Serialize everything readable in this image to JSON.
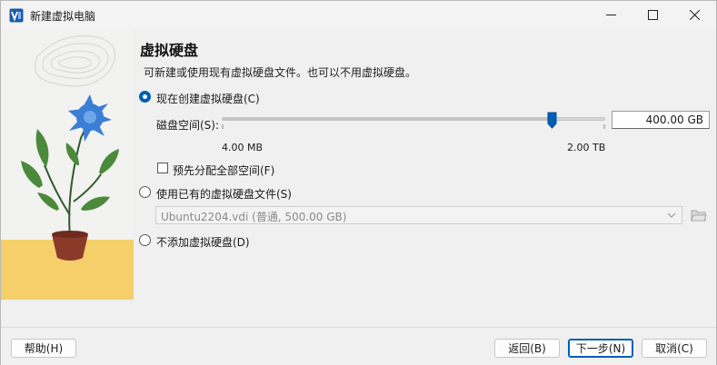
{
  "window": {
    "title": "新建虚拟电脑",
    "icons": {
      "app": "virtualbox-app-icon",
      "minimize": "minimize-icon",
      "maximize": "maximize-icon",
      "close": "close-icon"
    }
  },
  "page": {
    "title": "虚拟硬盘",
    "description": "可新建或使用现有虚拟硬盘文件。也可以不用虚拟硬盘。"
  },
  "options": {
    "create_new": {
      "label": "现在创建虚拟硬盘(C)",
      "selected": true
    },
    "use_existing": {
      "label": "使用已有的虚拟硬盘文件(S)",
      "selected": false
    },
    "no_disk": {
      "label": "不添加虚拟硬盘(D)",
      "selected": false
    }
  },
  "disk_size": {
    "label": "磁盘空间(S):",
    "value": "400.00 GB",
    "min_label": "4.00 MB",
    "max_label": "2.00 TB",
    "slider_fraction": 0.863
  },
  "preallocate": {
    "label": "预先分配全部空间(F)",
    "checked": false
  },
  "existing_disk": {
    "selected": "Ubuntu2204.vdi (普通, 500.00 GB)",
    "chevron_icon": "chevron-down-icon",
    "folder_icon": "folder-open-icon"
  },
  "buttons": {
    "help": "帮助(H)",
    "back": "返回(B)",
    "next": "下一步(N)",
    "cancel": "取消(C)"
  },
  "colors": {
    "accent": "#005fb8",
    "flower": "#3a7fd5",
    "pot": "#8b3a2a",
    "ground": "#f5cf6a"
  }
}
